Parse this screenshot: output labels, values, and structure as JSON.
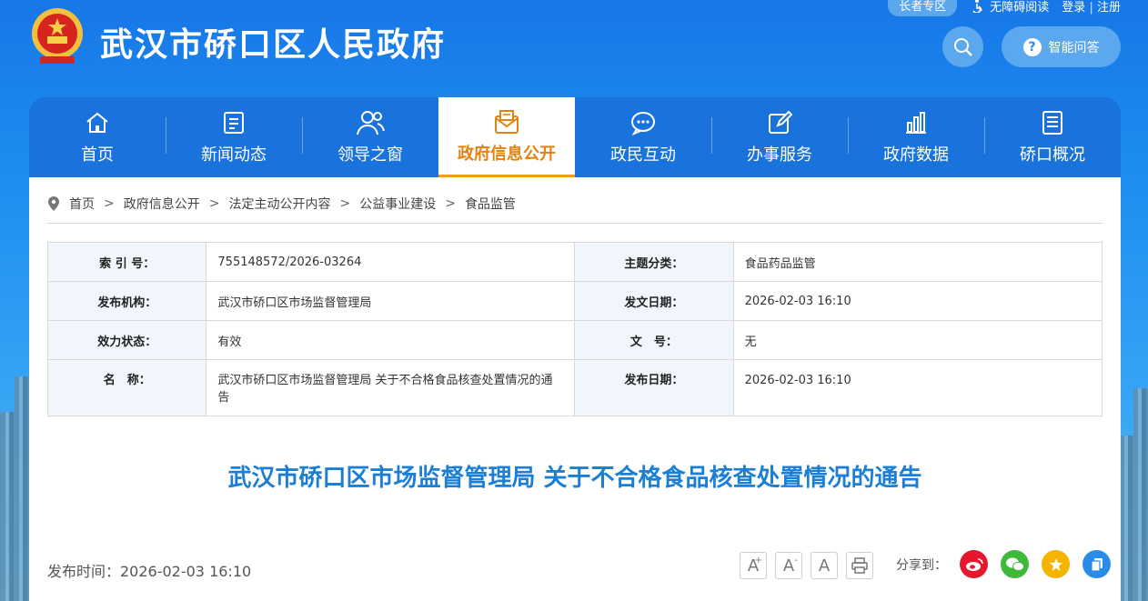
{
  "topbar": {
    "elder_mode": "长者专区",
    "accessible": "无障碍阅读",
    "login": "登录",
    "divider": "|",
    "register": "注册"
  },
  "header": {
    "title": "武汉市硚口区人民政府",
    "ai_label": "智能问答"
  },
  "nav": [
    {
      "label": "首页",
      "icon": "home-icon"
    },
    {
      "label": "新闻动态",
      "icon": "news-icon"
    },
    {
      "label": "领导之窗",
      "icon": "leaders-icon"
    },
    {
      "label": "政府信息公开",
      "icon": "envelope-icon",
      "active": true
    },
    {
      "label": "政民互动",
      "icon": "chat-icon"
    },
    {
      "label": "办事服务",
      "icon": "edit-icon"
    },
    {
      "label": "政府数据",
      "icon": "bar-chart-icon"
    },
    {
      "label": "硚口概况",
      "icon": "document-icon"
    }
  ],
  "breadcrumb": [
    "首页",
    "政府信息公开",
    "法定主动公开内容",
    "公益事业建设",
    "食品监管"
  ],
  "breadcrumb_sep": ">",
  "meta": {
    "index_label": "索 引 号：",
    "index_value": "755148572/2026-03264",
    "topic_label": "主题分类：",
    "topic_value": "食品药品监管",
    "publisher_label": "发布机构：",
    "publisher_value": "武汉市硚口区市场监督管理局",
    "issue_date_label": "发文日期：",
    "issue_date_value": "2026-02-03 16:10",
    "status_label": "效力状态：",
    "status_value": "有效",
    "doc_no_label": "文　号：",
    "doc_no_value": "无",
    "name_label": "名　称：",
    "name_value": "武汉市硚口区市场监督管理局 关于不合格食品核查处置情况的通告",
    "pub_date_label": "发布日期：",
    "pub_date_value": "2026-02-03 16:10"
  },
  "article": {
    "title": "武汉市硚口区市场监督管理局 关于不合格食品核查处置情况的通告",
    "publish_time": "发布时间：2026-02-03 16:10"
  },
  "tools": {
    "font_up": "A",
    "font_down": "A",
    "font_reset": "A"
  },
  "share": {
    "label": "分享到："
  },
  "colors": {
    "brand_blue": "#1a73dc",
    "active_orange": "#e28310",
    "title_blue": "#1c7fd6"
  }
}
